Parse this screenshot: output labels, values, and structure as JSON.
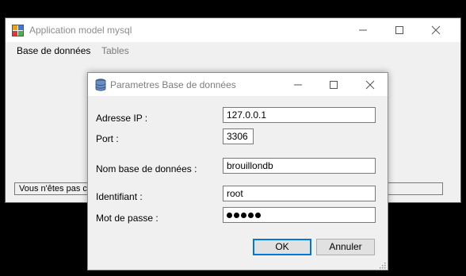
{
  "main_window": {
    "title": "Application model mysql",
    "menu": {
      "database": "Base de données",
      "tables": "Tables"
    },
    "status_text": "Vous n'êtes pas co"
  },
  "dialog": {
    "title": "Parametres Base de données",
    "labels": {
      "ip": "Adresse IP :",
      "port": "Port :",
      "db_name": "Nom base de données :",
      "user": "Identifiant :",
      "password": "Mot de passe :"
    },
    "values": {
      "ip": "127.0.0.1",
      "port": "3306",
      "db_name": "brouillondb",
      "user": "root",
      "password_dot_count": 5
    },
    "buttons": {
      "ok": "OK",
      "cancel": "Annuler"
    }
  },
  "colors": {
    "accent": "#0078d7",
    "window_bg": "#f0f0f0",
    "desktop": "#000000"
  },
  "icons": [
    "app-icon",
    "database-icon",
    "minimize-icon",
    "maximize-icon",
    "close-icon",
    "resize-grip-icon"
  ]
}
